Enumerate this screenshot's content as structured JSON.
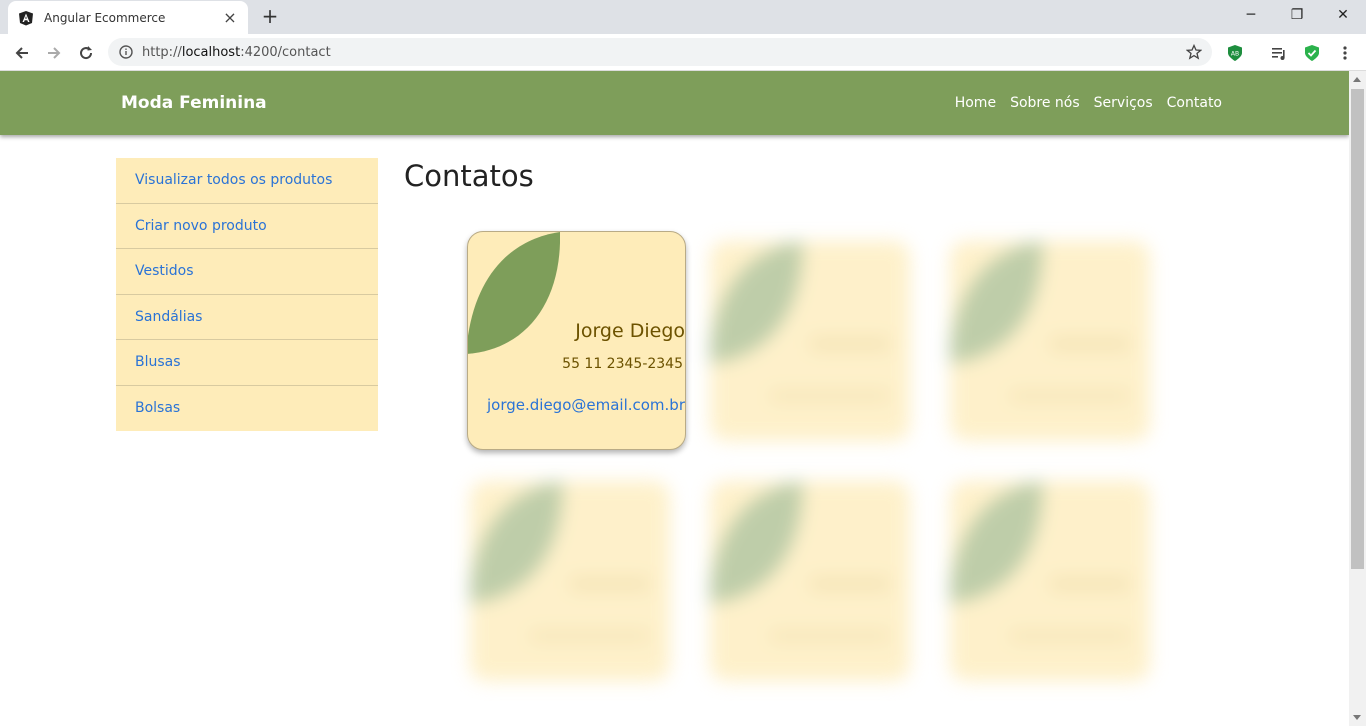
{
  "browser": {
    "tab_title": "Angular Ecommerce",
    "tab_close": "×",
    "new_tab": "+",
    "url_prefix": "http://",
    "url_host": "localhost",
    "url_rest": ":4200/contact",
    "window_controls": [
      "─",
      "❐",
      "✕"
    ]
  },
  "navbar": {
    "brand": "Moda Feminina",
    "links": [
      "Home",
      "Sobre nós",
      "Serviços",
      "Contato"
    ],
    "color": "#7e9e5a"
  },
  "sidebar": {
    "items": [
      "Visualizar todos os produtos",
      "Criar novo produto",
      "Vestidos",
      "Sandálias",
      "Blusas",
      "Bolsas"
    ],
    "background": "#feecb9"
  },
  "main": {
    "title": "Contatos",
    "contact": {
      "name": "Jorge Diego",
      "phone": "55 11 2345-2345",
      "email": "jorge.diego@email.com.br"
    }
  },
  "icons": {
    "favicon": "angular-logo-icon",
    "back": "arrow-left-icon",
    "forward": "arrow-right-icon",
    "reload": "reload-icon",
    "info": "info-icon",
    "star": "star-icon",
    "ext1": "adblock-icon",
    "ext2": "playlist-icon",
    "ext3": "shield-check-icon",
    "menu": "kebab-menu-icon"
  }
}
